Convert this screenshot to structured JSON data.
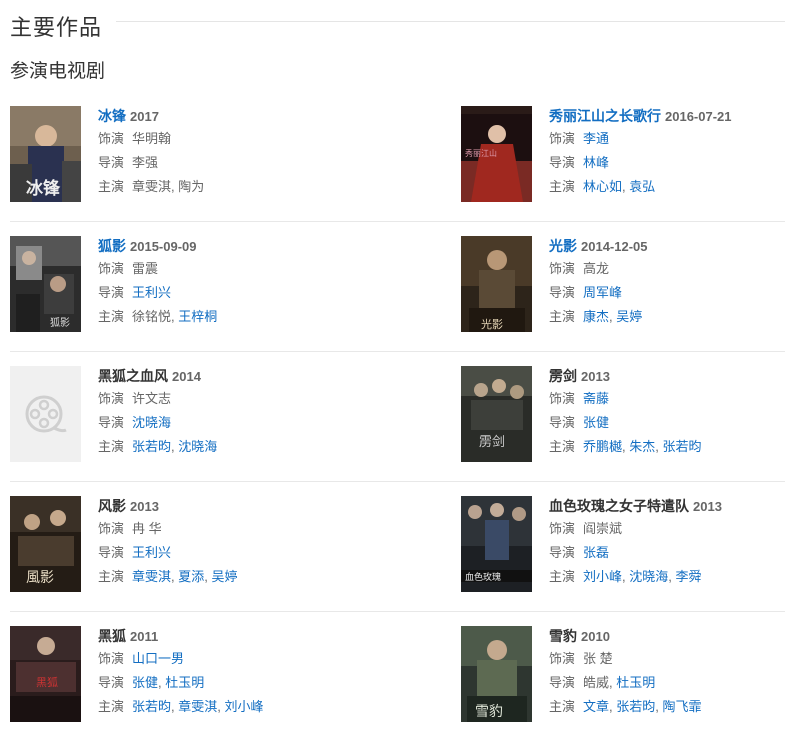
{
  "section": {
    "title": "主要作品"
  },
  "subsection": {
    "title": "参演电视剧"
  },
  "colors": {
    "link": "#136ec2",
    "text": "#333333",
    "muted": "#666666"
  },
  "labels": {
    "role": "饰演",
    "director": "导演",
    "cast": "主演"
  },
  "works": [
    {
      "title": "冰锋",
      "title_link": true,
      "year": "2017",
      "role": "华明翰",
      "role_link": false,
      "director": [
        {
          "name": "李强",
          "link": false
        }
      ],
      "cast": [
        {
          "name": "章雯淇",
          "link": false
        },
        {
          "name": "陶为",
          "link": false
        }
      ]
    },
    {
      "title": "秀丽江山之长歌行",
      "title_link": true,
      "year": "2016-07-21",
      "role": "李通",
      "role_link": true,
      "director": [
        {
          "name": "林峰",
          "link": true
        }
      ],
      "cast": [
        {
          "name": "林心如",
          "link": true
        },
        {
          "name": "袁弘",
          "link": true
        }
      ]
    },
    {
      "title": "狐影",
      "title_link": true,
      "year": "2015-09-09",
      "role": "雷震",
      "role_link": false,
      "director": [
        {
          "name": "王利兴",
          "link": true
        }
      ],
      "cast": [
        {
          "name": "徐铭悦",
          "link": false
        },
        {
          "name": "王梓桐",
          "link": true
        }
      ]
    },
    {
      "title": "光影",
      "title_link": true,
      "year": "2014-12-05",
      "role": "高龙",
      "role_link": false,
      "director": [
        {
          "name": "周军峰",
          "link": true
        }
      ],
      "cast": [
        {
          "name": "康杰",
          "link": true
        },
        {
          "name": "吴婷",
          "link": true
        }
      ]
    },
    {
      "title": "黑狐之血风",
      "title_link": false,
      "year": "2014",
      "role": "许文志",
      "role_link": false,
      "director": [
        {
          "name": "沈晓海",
          "link": true
        }
      ],
      "cast": [
        {
          "name": "张若昀",
          "link": true
        },
        {
          "name": "沈晓海",
          "link": true
        }
      ]
    },
    {
      "title": "雳剑",
      "title_link": false,
      "year": "2013",
      "role": "斋藤",
      "role_link": true,
      "director": [
        {
          "name": "张健",
          "link": true
        }
      ],
      "cast": [
        {
          "name": "乔鹏樾",
          "link": true
        },
        {
          "name": "朱杰",
          "link": true
        },
        {
          "name": "张若昀",
          "link": true
        }
      ]
    },
    {
      "title": "风影",
      "title_link": false,
      "year": "2013",
      "role": "冉 华",
      "role_link": false,
      "director": [
        {
          "name": "王利兴",
          "link": true
        }
      ],
      "cast": [
        {
          "name": "章雯淇",
          "link": true
        },
        {
          "name": "夏添",
          "link": true
        },
        {
          "name": "吴婷",
          "link": true
        }
      ]
    },
    {
      "title": "血色玫瑰之女子特遣队",
      "title_link": false,
      "year": "2013",
      "role": "阎崇斌",
      "role_link": false,
      "director": [
        {
          "name": "张磊",
          "link": true
        }
      ],
      "cast": [
        {
          "name": "刘小峰",
          "link": true
        },
        {
          "name": "沈晓海",
          "link": true
        },
        {
          "name": "李舜",
          "link": true
        }
      ]
    },
    {
      "title": "黑狐",
      "title_link": false,
      "year": "2011",
      "role": "山口一男",
      "role_link": true,
      "director": [
        {
          "name": "张健",
          "link": true
        },
        {
          "name": "杜玉明",
          "link": true
        }
      ],
      "cast": [
        {
          "name": "张若昀",
          "link": true
        },
        {
          "name": "章雯淇",
          "link": true
        },
        {
          "name": "刘小峰",
          "link": true
        }
      ]
    },
    {
      "title": "雪豹",
      "title_link": false,
      "year": "2010",
      "role": "张 楚",
      "role_link": false,
      "director": [
        {
          "name": "皓威",
          "link": false
        },
        {
          "name": "杜玉明",
          "link": true
        }
      ],
      "cast": [
        {
          "name": "文章",
          "link": true
        },
        {
          "name": "张若昀",
          "link": true
        },
        {
          "name": "陶飞霏",
          "link": true
        }
      ]
    }
  ],
  "posters": [
    {
      "icon": "poster-image",
      "bg": "#6d5f4e"
    },
    {
      "icon": "poster-image",
      "bg": "#7a2a24"
    },
    {
      "icon": "poster-image",
      "bg": "#3b3b3b"
    },
    {
      "icon": "poster-image",
      "bg": "#4a3a28"
    },
    {
      "icon": "film-reel-icon",
      "bg": "#f0f0f0"
    },
    {
      "icon": "poster-image",
      "bg": "#3d3f3a"
    },
    {
      "icon": "poster-image",
      "bg": "#3a3026"
    },
    {
      "icon": "poster-image",
      "bg": "#2e3338"
    },
    {
      "icon": "poster-image",
      "bg": "#3a2a2a"
    },
    {
      "icon": "poster-image",
      "bg": "#4d5a4a"
    }
  ]
}
